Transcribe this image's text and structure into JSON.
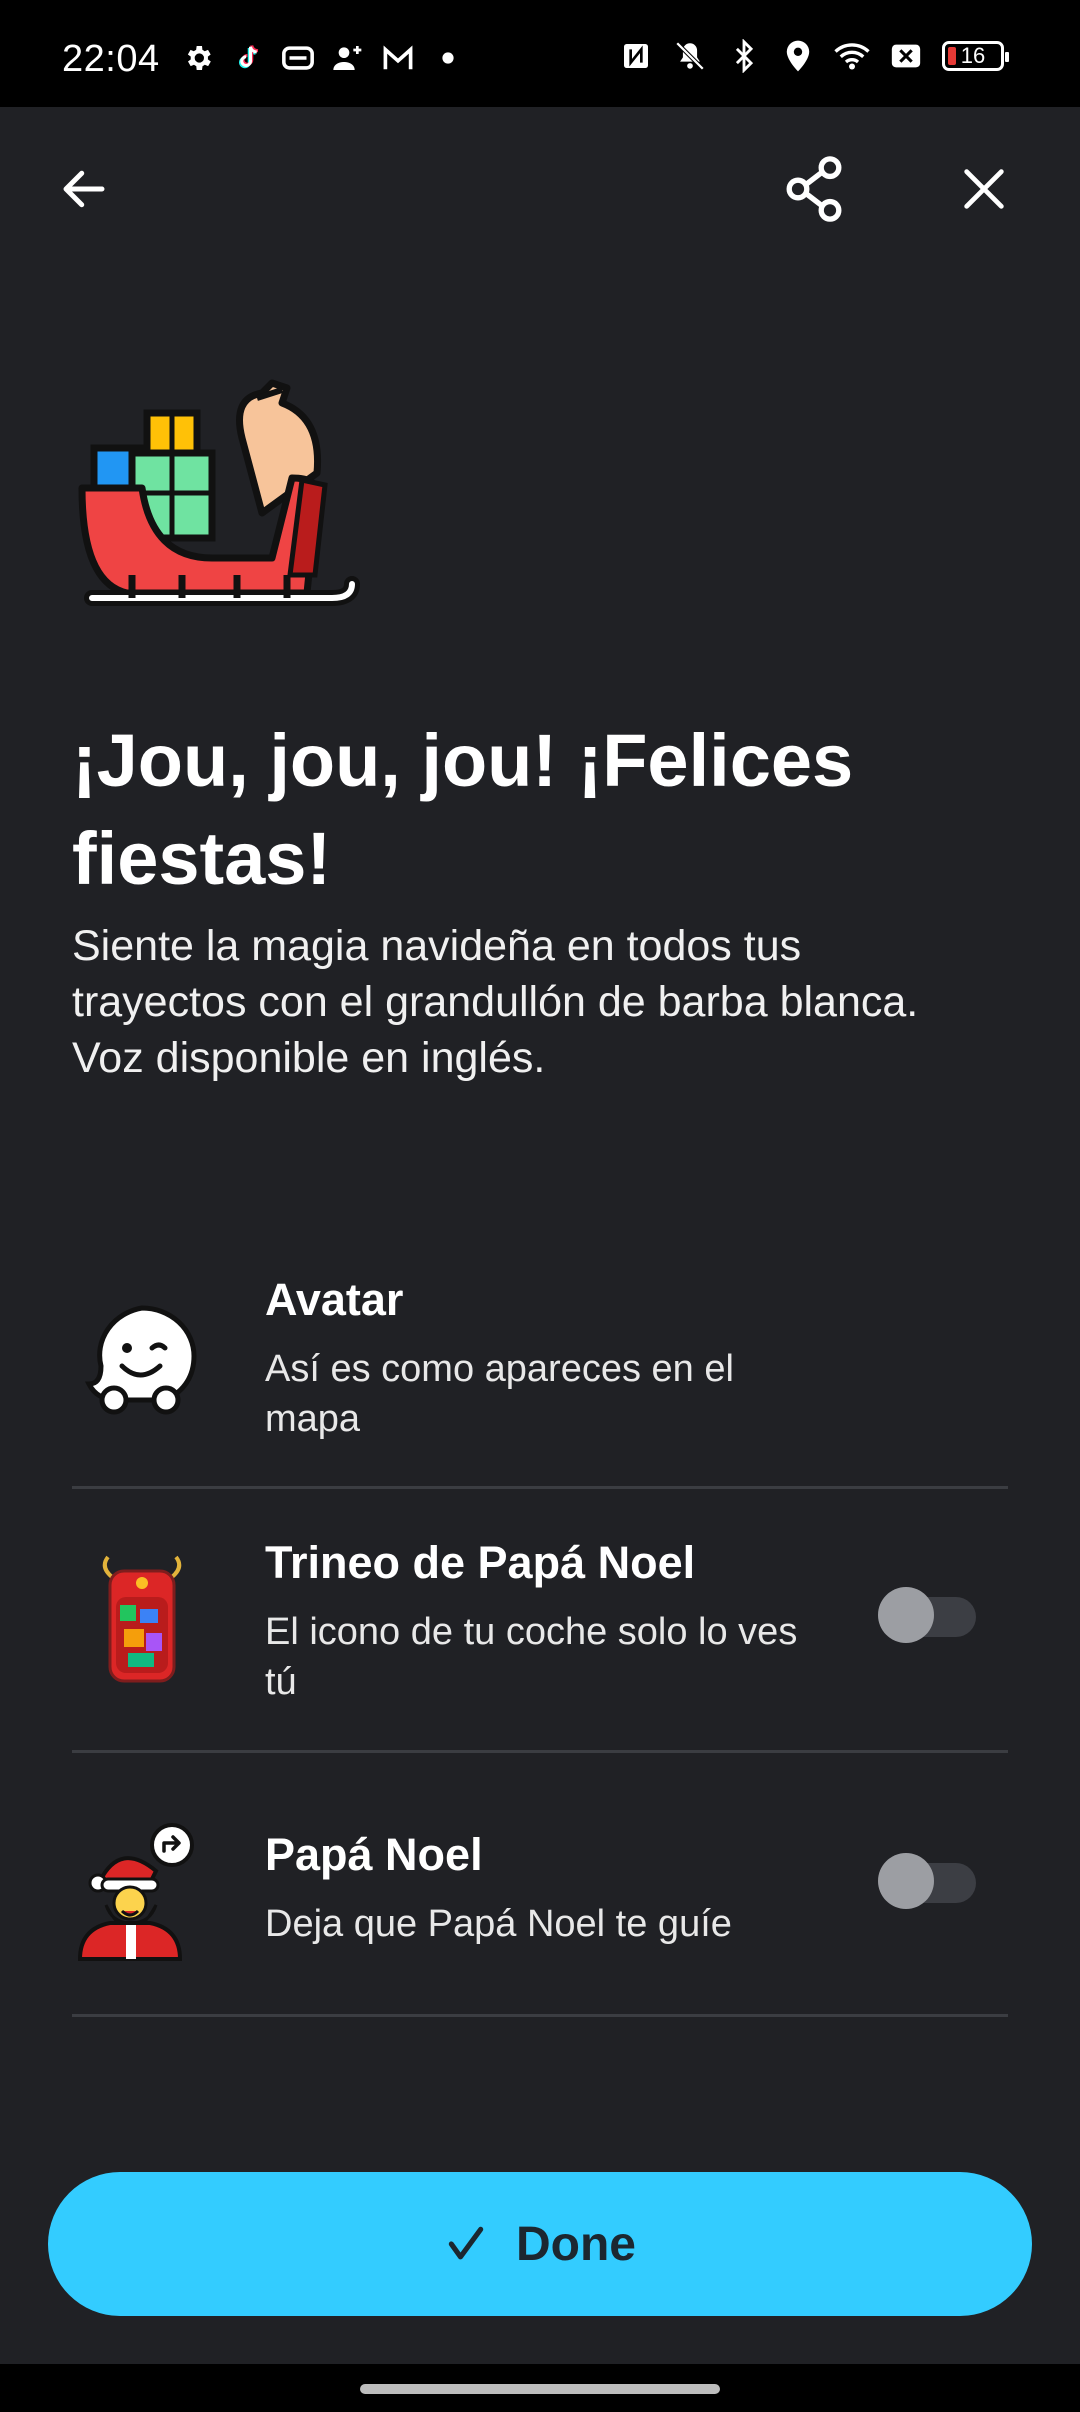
{
  "status_bar": {
    "time": "22:04",
    "battery": "16",
    "left_icons": [
      "gear-icon",
      "tiktok-icon",
      "ticket-icon",
      "add-person-icon",
      "gmail-icon",
      "dot-icon"
    ],
    "right_icons": [
      "nfc-icon",
      "mute-icon",
      "bluetooth-icon",
      "location-icon",
      "wifi-icon",
      "close-box-icon",
      "battery-icon"
    ]
  },
  "header": {
    "back_icon": "arrow-left-icon",
    "share_icon": "share-icon",
    "close_icon": "close-icon"
  },
  "hero_icon": "santa-sleigh-icon",
  "content": {
    "title": "¡Jou, jou, jou! ¡Felices fiestas!",
    "subtitle": "Siente la magia navideña en todos tus trayectos con el grandullón de barba blanca.\nVoz disponible en inglés."
  },
  "options": [
    {
      "title": "Avatar",
      "description": "Así es como apareces en el mapa",
      "icon": "waze-avatar-icon"
    },
    {
      "title": "Trineo de Papá Noel",
      "description": "El icono de tu coche solo lo ves tú",
      "icon": "sleigh-car-icon",
      "toggle_on": false
    },
    {
      "title": "Papá Noel",
      "description": "Deja que Papá Noel te guíe",
      "icon": "santa-voice-icon",
      "toggle_on": false
    }
  ],
  "done_button": {
    "label": "Done",
    "icon": "check-icon"
  },
  "colors": {
    "background": "#202125",
    "accent": "#33ccff",
    "divider": "#3b3d42"
  }
}
